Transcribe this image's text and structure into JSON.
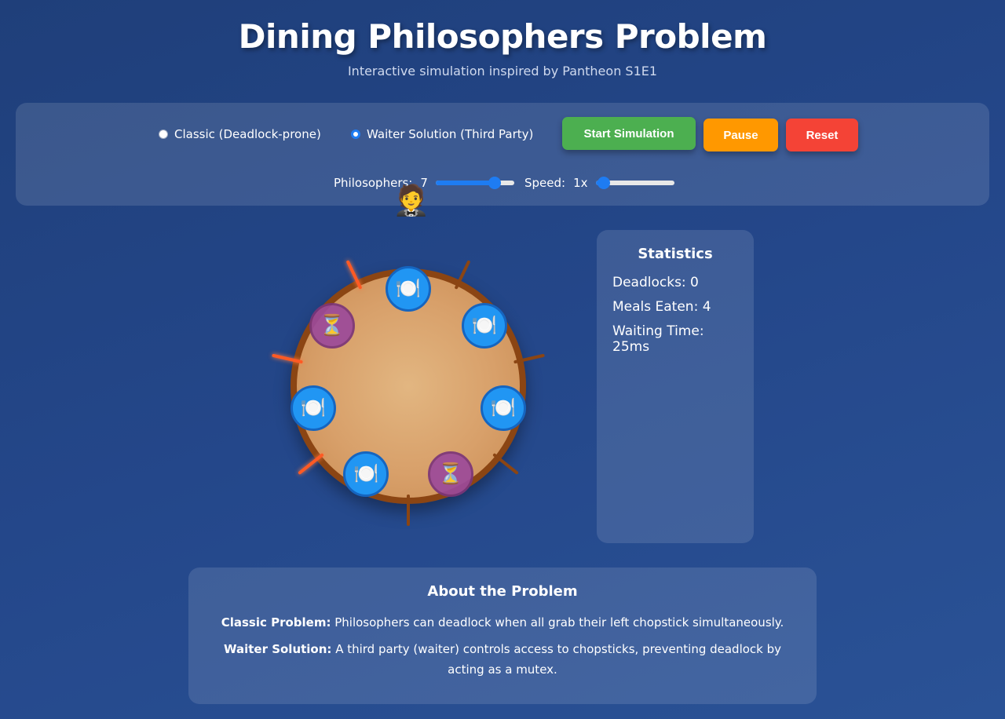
{
  "header": {
    "title": "Dining Philosophers Problem",
    "subtitle": "Interactive simulation inspired by Pantheon S1E1"
  },
  "controls": {
    "modes": [
      {
        "label": "Classic (Deadlock-prone)",
        "checked": false
      },
      {
        "label": "Waiter Solution (Third Party)",
        "checked": true
      }
    ],
    "buttons": {
      "start": "Start Simulation",
      "pause": "Pause",
      "reset": "Reset"
    },
    "philosophers": {
      "label": "Philosophers:",
      "value": "7",
      "fraction": 0.75
    },
    "speed": {
      "label": "Speed:",
      "value": "1x",
      "fraction": 0.1
    }
  },
  "icons": {
    "waiter": "waiter-icon",
    "eating": "plate-cutlery-icon",
    "waiting": "hourglass-icon"
  },
  "philosophers": [
    {
      "id": 0,
      "state": "eating"
    },
    {
      "id": 1,
      "state": "eating"
    },
    {
      "id": 2,
      "state": "eating"
    },
    {
      "id": 3,
      "state": "waiting"
    },
    {
      "id": 4,
      "state": "eating"
    },
    {
      "id": 5,
      "state": "eating"
    },
    {
      "id": 6,
      "state": "waiting"
    }
  ],
  "chopsticks": [
    {
      "id": 0,
      "active": false
    },
    {
      "id": 1,
      "active": false
    },
    {
      "id": 2,
      "active": false
    },
    {
      "id": 3,
      "active": false
    },
    {
      "id": 4,
      "active": true
    },
    {
      "id": 5,
      "active": true
    },
    {
      "id": 6,
      "active": true
    }
  ],
  "colors": {
    "eating": "#2196f3",
    "waiting": "#9c4a9a",
    "start": "#4caf50",
    "pause": "#ff9800",
    "reset": "#f44336",
    "chopstick": "#8b4513",
    "chopstick_active": "#ff5a24"
  },
  "stats": {
    "title": "Statistics",
    "deadlocks": "Deadlocks: 0",
    "meals": "Meals Eaten: 4",
    "waiting": "Waiting Time: 25ms"
  },
  "about": {
    "title": "About the Problem",
    "classic_label": "Classic Problem:",
    "classic_text": " Philosophers can deadlock when all grab their left chopstick simultaneously.",
    "waiter_label": "Waiter Solution:",
    "waiter_text": " A third party (waiter) controls access to chopsticks, preventing deadlock by acting as a mutex."
  }
}
